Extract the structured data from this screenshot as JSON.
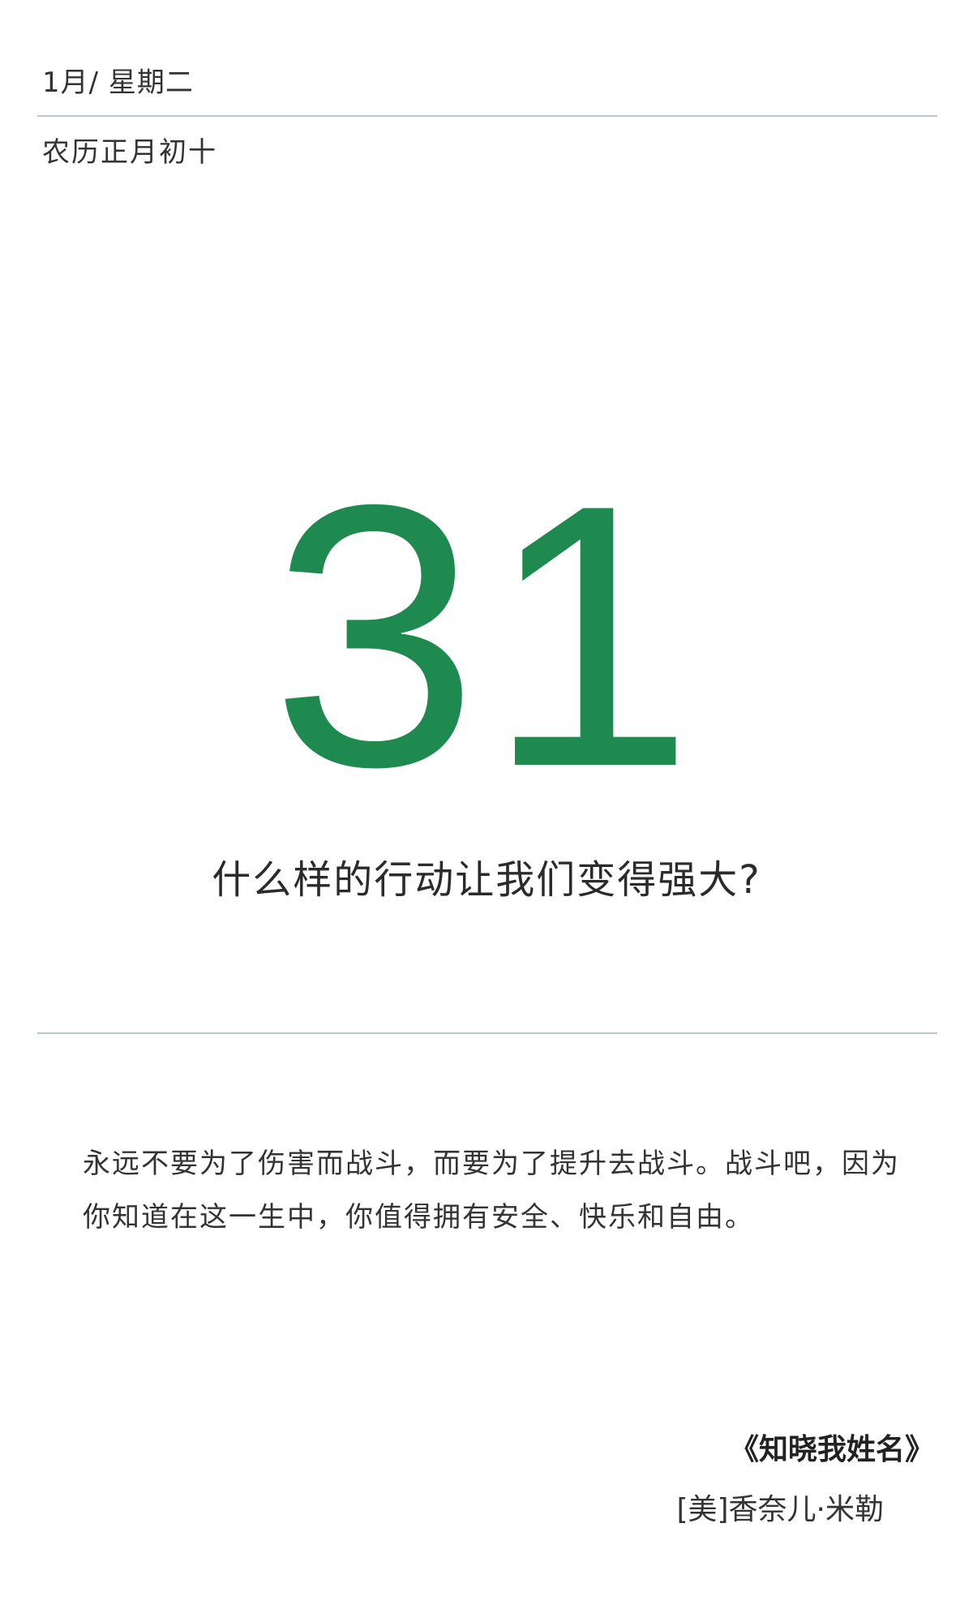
{
  "header": {
    "month_weekday": "1月/ 星期二",
    "lunar_date": "农历正月初十"
  },
  "day_number": "31",
  "question": "什么样的行动让我们变得强大?",
  "quote": {
    "lines": [
      "永远不要为了伤害而战斗，而要为了提升去战斗。战斗吧，因为",
      "你知道在这一生中，你值得拥有安全、快乐和自由。"
    ]
  },
  "source": {
    "book_title": "《知晓我姓名》",
    "author": "[美]香奈儿·米勒"
  },
  "colors": {
    "accent_green": "#1e8a4f",
    "divider": "#b9c8cc"
  }
}
